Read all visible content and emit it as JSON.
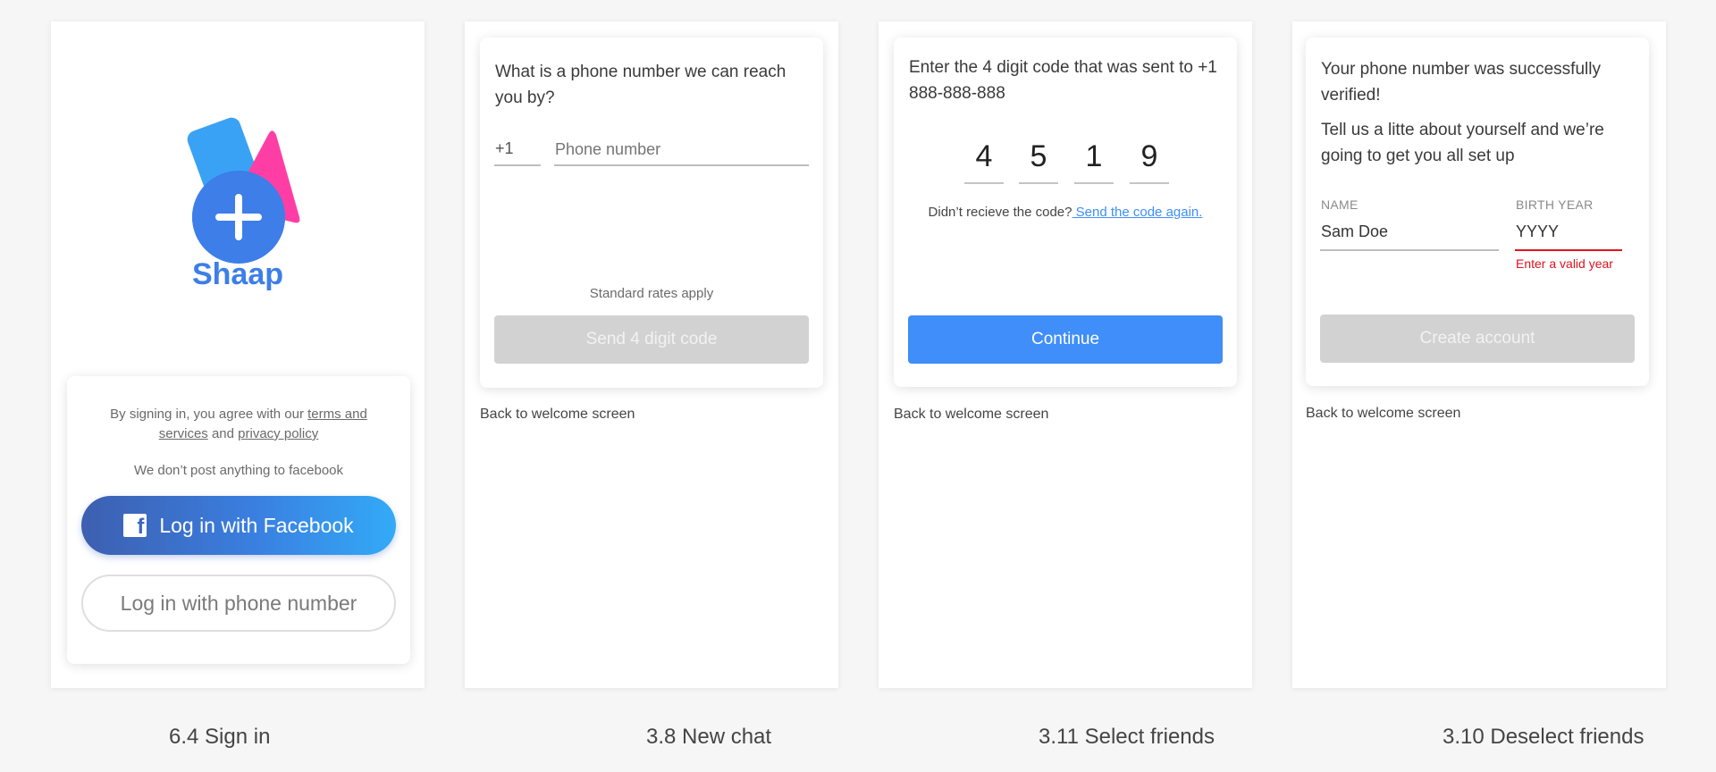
{
  "screens": [
    {
      "brand": "Shaap",
      "terms_prefix": "By signing in, you agree with our ",
      "terms_link": "terms and services",
      "terms_and": " and ",
      "privacy_link": "privacy policy",
      "no_post_note": "We don’t post anything to facebook",
      "facebook_button": "Log in with Facebook",
      "phone_button": "Log in with phone number",
      "caption": "6.4 Sign in"
    },
    {
      "question": "What is a phone number we can reach you by?",
      "country_code": "+1",
      "phone_placeholder": "Phone number",
      "rates_note": "Standard rates apply",
      "send_button": "Send 4 digit code",
      "back_link": "Back to welcome screen",
      "caption": "3.8 New chat"
    },
    {
      "prompt": "Enter the 4 digit code that was sent to +1 888-888-888",
      "digits": [
        "4",
        "5",
        "1",
        "9"
      ],
      "resend_prefix": "Didn’t recieve the code?",
      "resend_link": " Send the code again.",
      "continue_button": "Continue",
      "back_link": "Back to welcome screen",
      "caption": "3.11 Select friends"
    },
    {
      "success_text": "Your phone number was successfully verified!",
      "intro_text": "Tell us a litte about yourself and we’re going to get you all set up",
      "name_label": "NAME",
      "name_value": "Sam Doe",
      "birth_year_label": "BIRTH YEAR",
      "birth_year_value": "YYYY",
      "birth_year_error": "Enter a valid year",
      "create_button": "Create account",
      "back_link": "Back to welcome screen",
      "caption": "3.10 Deselect friends"
    }
  ],
  "colors": {
    "accent_blue": "#3f8ef9",
    "brand_blue": "#3d7ee8",
    "logo_pink": "#ff3ea5",
    "logo_light_blue": "#3aa2f5",
    "error_red": "#e0121f",
    "disabled_gray": "#d2d2d2"
  },
  "icons": [
    "plus-icon",
    "facebook-icon"
  ]
}
